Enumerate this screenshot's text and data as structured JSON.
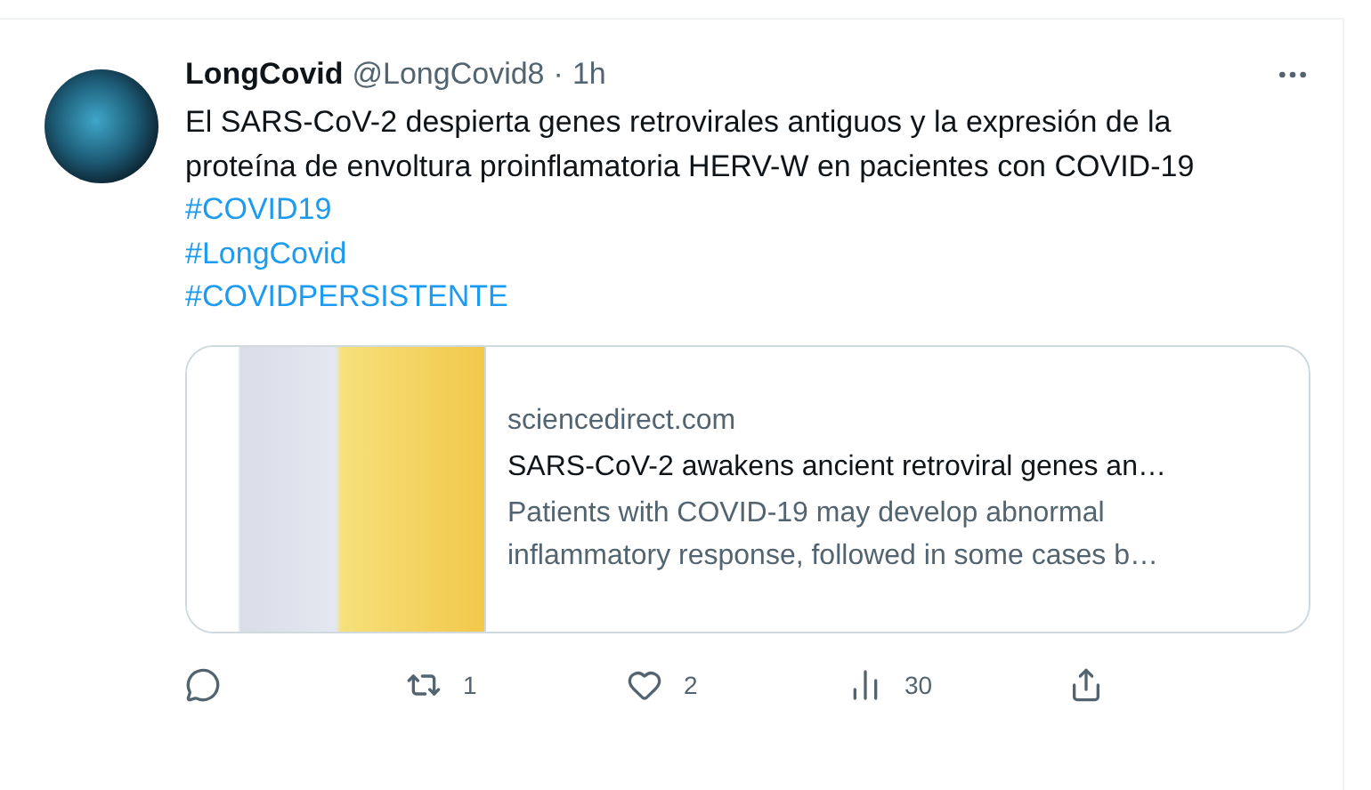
{
  "tweet": {
    "author": {
      "name": "LongCovid",
      "handle": "@LongCovid8",
      "separator": "·",
      "time": "1h"
    },
    "text": "El SARS-CoV-2 despierta genes retrovirales antiguos y la expresión de la proteína de envoltura proinflamatoria HERV-W en pacientes con COVID-19",
    "hashtags": [
      "#COVID19",
      "#LongCovid",
      "#COVIDPERSISTENTE"
    ],
    "link_card": {
      "domain": "sciencedirect.com",
      "title": "SARS-CoV-2 awakens ancient retroviral genes an…",
      "description": "Patients with COVID-19 may develop abnormal inflammatory response, followed in some cases b…"
    },
    "actions": [
      {
        "kind": "reply"
      },
      {
        "kind": "retweet",
        "count": "1"
      },
      {
        "kind": "like",
        "count": "2"
      },
      {
        "kind": "views",
        "count": "30"
      },
      {
        "kind": "share"
      }
    ]
  }
}
